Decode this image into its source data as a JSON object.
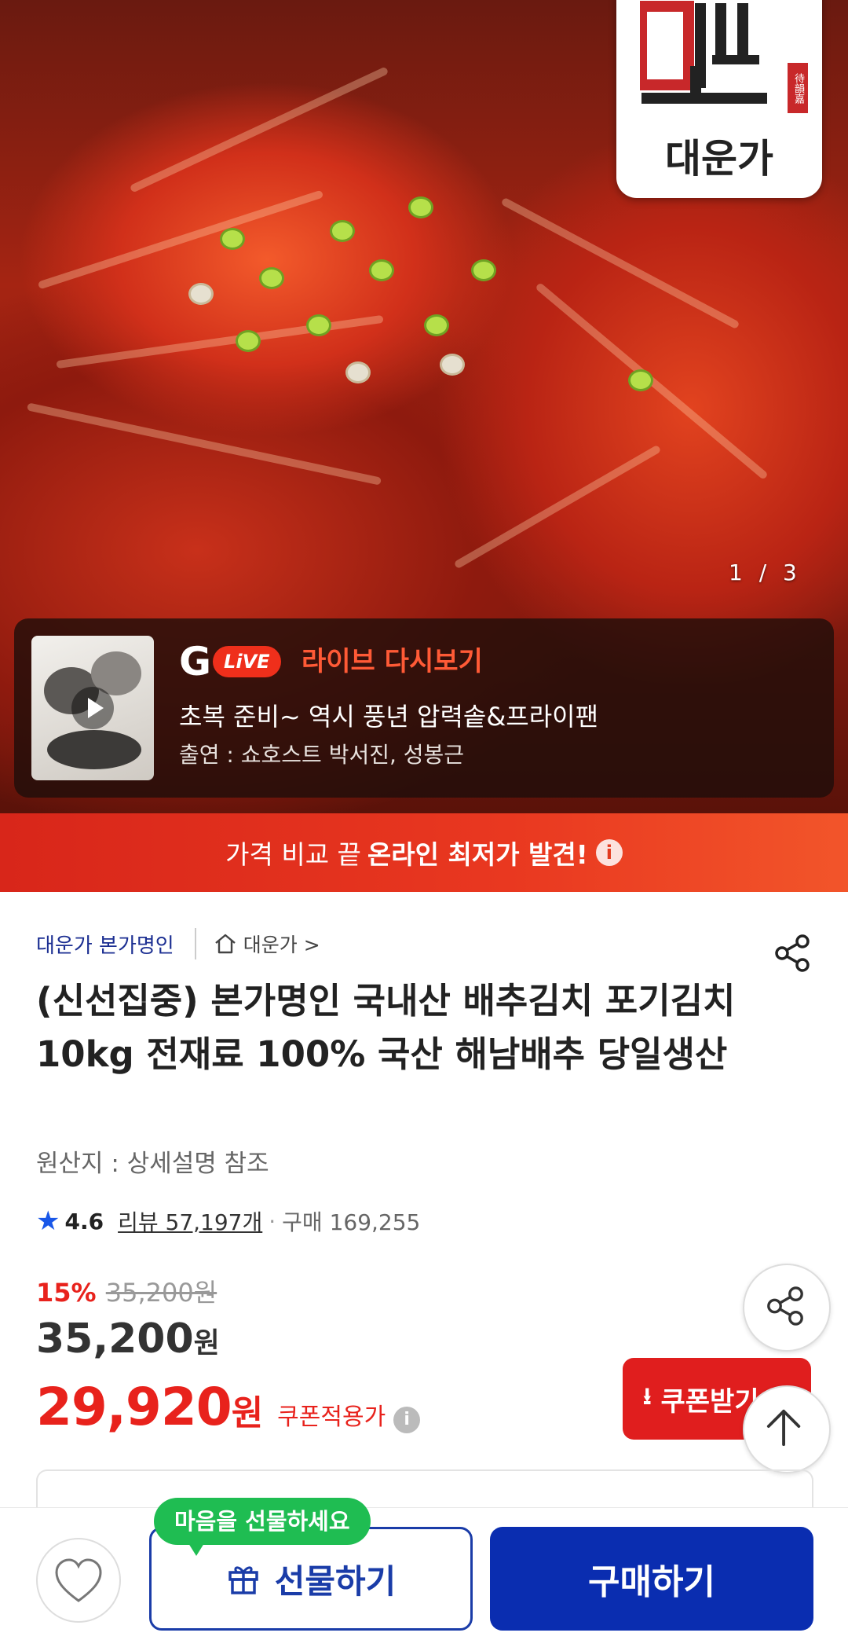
{
  "hero": {
    "brand_logo_text": "대운가",
    "brand_seal_text": "待韻嘉",
    "image_counter": "1 / 3"
  },
  "live": {
    "badge_g": "G",
    "badge_live": "LiVE",
    "title": "라이브 다시보기",
    "line1": "초복 준비~ 역시 풍년 압력솥&프라이팬",
    "line2": "출연 : 쇼호스트 박서진, 성봉근"
  },
  "banner": {
    "text_plain": "가격 비교 끝",
    "text_bold": "온라인 최저가 발견!",
    "info": "i"
  },
  "product": {
    "seller": "대운가 본가명인",
    "store": "대운가",
    "store_chevron": ">",
    "title": "(신선집중) 본가명인 국내산 배추김치 포기김치 10kg 전재료 100% 국산 해남배추 당일생산",
    "origin": "원산지 : 상세설명 참조",
    "rating": "4.6",
    "reviews": "리뷰 57,197개",
    "separator": "·",
    "purchases": "구매 169,255"
  },
  "price": {
    "discount_pct": "15%",
    "original": "35,200원",
    "current_num": "35,200",
    "current_unit": "원",
    "coupon_num": "29,920",
    "coupon_unit": "원",
    "coupon_label": "쿠폰적용가",
    "coupon_info": "i",
    "coupon_button": "쿠폰받기"
  },
  "bottom_bar": {
    "tooltip": "마음을 선물하세요",
    "gift_label": "선물하기",
    "buy_label": "구매하기"
  },
  "colors": {
    "accent_red": "#e8221c",
    "brand_blue": "#0a2db0",
    "tooltip_green": "#1fbd52"
  }
}
